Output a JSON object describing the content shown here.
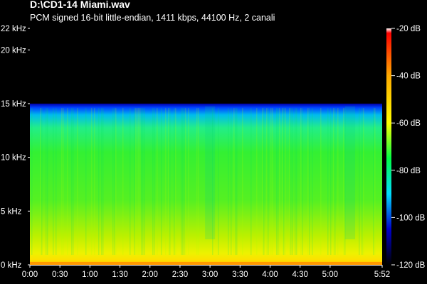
{
  "header": {
    "title": "D:\\CD1-14 Miami.wav",
    "subtitle": "PCM signed 16-bit little-endian, 1411 kbps, 44100 Hz, 2 canali"
  },
  "colors": {
    "background": "#000000",
    "colormap": [
      "#ffffff",
      "#ff0000",
      "#ffaa00",
      "#ffff00",
      "#00ff44",
      "#00ddff",
      "#0000cc",
      "#000000"
    ]
  },
  "chart_data": {
    "type": "heatmap",
    "title": "D:\\CD1-14 Miami.wav",
    "subtitle": "PCM signed 16-bit little-endian, 1411 kbps, 44100 Hz, 2 canali",
    "xlabel": "",
    "ylabel": "",
    "x_unit": "time (m:ss)",
    "y_unit": "kHz",
    "xlim": [
      "0:00",
      "5:52"
    ],
    "ylim_khz": [
      0,
      22
    ],
    "duration_seconds": 352,
    "x_ticks": [
      "0:00",
      "0:30",
      "1:00",
      "1:30",
      "2:00",
      "2:30",
      "3:00",
      "3:30",
      "4:00",
      "4:30",
      "5:00",
      "5:52"
    ],
    "y_ticks": [
      "0 kHz",
      "5 kHz",
      "10 kHz",
      "15 kHz",
      "20 kHz",
      "22 kHz"
    ],
    "colorbar": {
      "unit": "dB",
      "range_db": [
        -120,
        -20
      ],
      "ticks": [
        "-20 dB",
        "-40 dB",
        "-60 dB",
        "-80 dB",
        "-100 dB",
        "-120 dB"
      ]
    },
    "spectral_profile": {
      "cutoff_khz": 15,
      "bands": [
        {
          "from_khz": 0,
          "to_khz": 0.3,
          "db": -35
        },
        {
          "from_khz": 0.3,
          "to_khz": 1.5,
          "db": -50
        },
        {
          "from_khz": 1.5,
          "to_khz": 4,
          "db": -53
        },
        {
          "from_khz": 4,
          "to_khz": 10,
          "db": -60
        },
        {
          "from_khz": 10,
          "to_khz": 13.8,
          "db": -64
        },
        {
          "from_khz": 13.8,
          "to_khz": 14.6,
          "db": -72
        },
        {
          "from_khz": 14.6,
          "to_khz": 15,
          "db": -95
        },
        {
          "from_khz": 15,
          "to_khz": 22,
          "db": -120
        }
      ]
    }
  }
}
